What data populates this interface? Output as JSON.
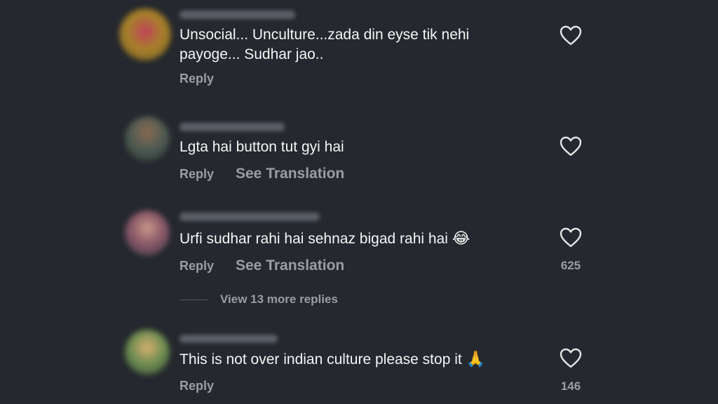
{
  "colors": {
    "background": "#25282e",
    "text_primary": "#f5f5f5",
    "text_secondary": "#9a9da3"
  },
  "comments": [
    {
      "text": "Unsocial... Unculture...zada din eyse tik nehi payoge... Sudhar jao..",
      "reply_label": "Reply",
      "translation_label": "",
      "likes": "",
      "emoji": ""
    },
    {
      "text": "Lgta hai button tut gyi hai",
      "reply_label": "Reply",
      "translation_label": "See Translation",
      "likes": "",
      "emoji": ""
    },
    {
      "text": "Urfi sudhar rahi hai sehnaz bigad rahi hai",
      "reply_label": "Reply",
      "translation_label": "See Translation",
      "likes": "625",
      "emoji": "😂"
    },
    {
      "text": "This is not over indian culture please stop it",
      "reply_label": "Reply",
      "translation_label": "",
      "likes": "146",
      "emoji": "🙏"
    }
  ],
  "view_more_replies": "View 13 more replies",
  "icons": {
    "like": "heart-outline-icon"
  }
}
